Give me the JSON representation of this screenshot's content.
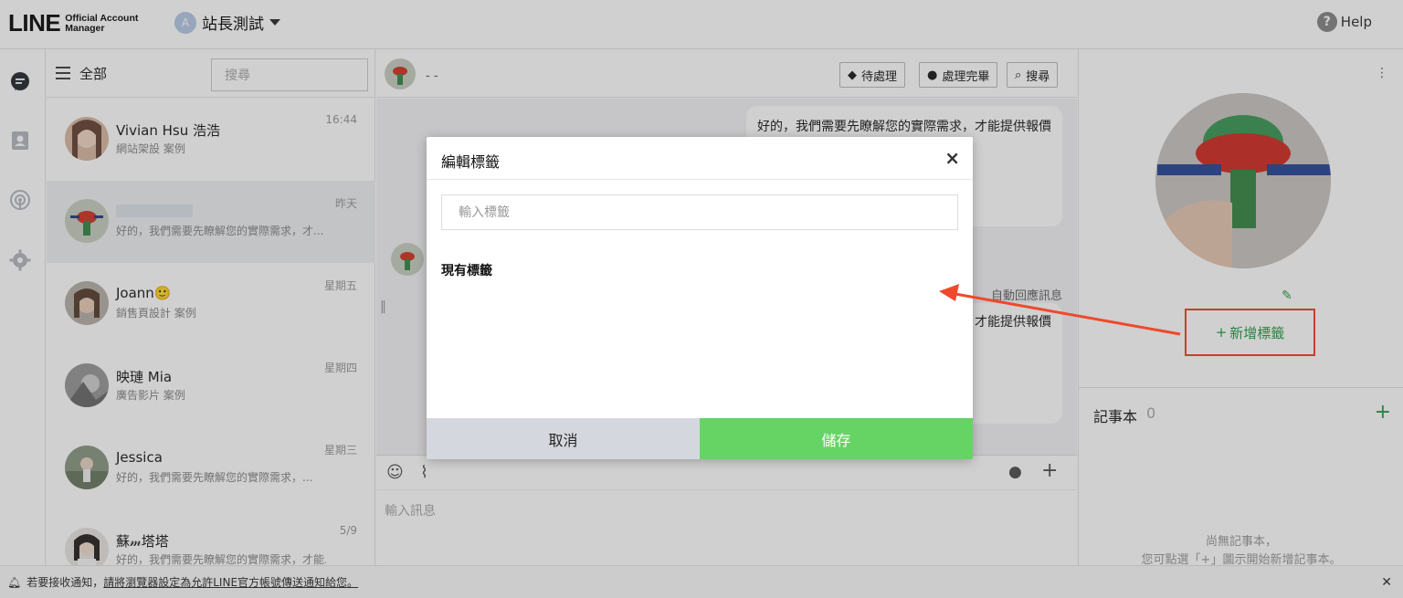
{
  "header": {
    "logo_main": "LINE",
    "logo_sub1": "Official Account",
    "logo_sub2": "Manager",
    "account_initial": "A",
    "account_name": "站長測試",
    "help_label": "Help"
  },
  "chat_list": {
    "title": "全部",
    "search_placeholder": "搜尋",
    "items": [
      {
        "name": "Vivian Hsu 浩浩",
        "preview": "網站架設 案例",
        "time": "16:44"
      },
      {
        "name": "",
        "preview": "好的，我們需要先瞭解您的實際需求，才...",
        "time": "昨天"
      },
      {
        "name": "Joann",
        "emoji": "🙂",
        "preview": "銷售頁設計 案例",
        "time": "星期五"
      },
      {
        "name": "映璉 Mia",
        "preview": "廣告影片 案例",
        "time": "星期四"
      },
      {
        "name": "Jessica",
        "preview": "好的，我們需要先瞭解您的實際需求，...",
        "time": "星期三"
      },
      {
        "name": "蘇𝓂塔塔",
        "preview": "好的，我們需要先瞭解您的實際需求，才能...",
        "time": "5/9"
      }
    ]
  },
  "chat": {
    "header_name": "- -",
    "btn_pending": "待處理",
    "btn_done": "處理完畢",
    "btn_search": "搜尋",
    "message_1": "好的，我們需要先瞭解您的實際需求，才能提供報價",
    "auto_reply_label": "自動回應訊息",
    "message_2_tail": "才能提供報價",
    "compose_placeholder": "輸入訊息"
  },
  "right_panel": {
    "add_tag": "新增標籤",
    "notes_title": "記事本",
    "notes_count": "0",
    "empty_line1": "尚無記事本，",
    "empty_line2": "您可點選「+」圖示開始新增記事本。"
  },
  "notification": {
    "prefix": "若要接收通知，",
    "link": "請將瀏覽器設定為允許LINE官方帳號傳送通知給您。"
  },
  "modal": {
    "title": "編輯標籤",
    "input_placeholder": "輸入標籤",
    "existing_label": "現有標籤",
    "cancel": "取消",
    "save": "儲存"
  },
  "colors": {
    "accent_green": "#66d365",
    "annotation_red": "#f0482b",
    "tag_green": "#2a9d4a"
  }
}
